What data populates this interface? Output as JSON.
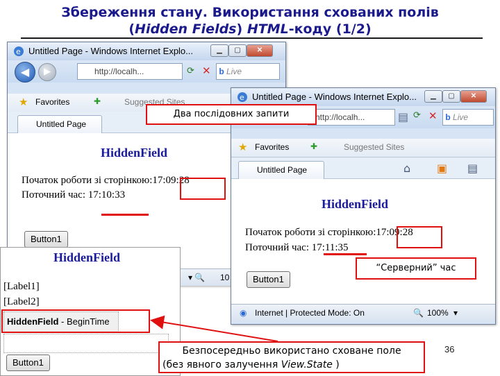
{
  "slide": {
    "title_line1": "Збереження стану. Використання схованих полів",
    "title_line2_pre": "(",
    "title_line2_italic1": "Hidden Fields",
    "title_line2_mid": ") ",
    "title_line2_italic2": "HTML",
    "title_line2_post": "-коду (1/2)",
    "page_number": "36"
  },
  "browser1": {
    "window_title": "Untitled Page - Windows Internet Explo...",
    "address": "http://localh...",
    "live_label": "Live",
    "favorites_label": "Favorites",
    "suggested_sites": "Suggested Sites",
    "tab_label": "Untitled Page",
    "heading": "HiddenField",
    "start_label": "Початок роботи зі сторінкою:",
    "start_time": "17:09:28",
    "current_label": "Поточний час:",
    "current_time": "17:10:33",
    "button_label": "Button1",
    "zoom_partial": "10"
  },
  "browser2": {
    "window_title": "Untitled Page - Windows Internet Explo...",
    "address": "http://localh...",
    "live_label": "Live",
    "favorites_label": "Favorites",
    "suggested_sites": "Suggested Sites",
    "tab_label": "Untitled Page",
    "heading": "HiddenField",
    "start_label": "Початок роботи зі сторінкою:",
    "start_time": "17:09:28",
    "current_label": "Поточний час:",
    "current_time": "17:11:35",
    "button_label": "Button1",
    "status_text": "Internet | Protected Mode: On",
    "zoom": "100%"
  },
  "designer": {
    "heading": "HiddenField",
    "label1": "[Label1]",
    "label2": "[Label2]",
    "hiddenfield_bold": "HiddenField",
    "hiddenfield_rest": " - BeginTime",
    "button_label": "Button1"
  },
  "callouts": {
    "two_requests": "Два послідовних запити",
    "server_time": "“Серверний” час",
    "note_line1": "Безпосередньо використано сховане поле",
    "note_line2_pre": "(без явного залучення ",
    "note_line2_italic": "View.State",
    "note_line2_post": " )"
  },
  "colors": {
    "accent_red": "#e01010",
    "title_blue": "#1a1a8c"
  }
}
